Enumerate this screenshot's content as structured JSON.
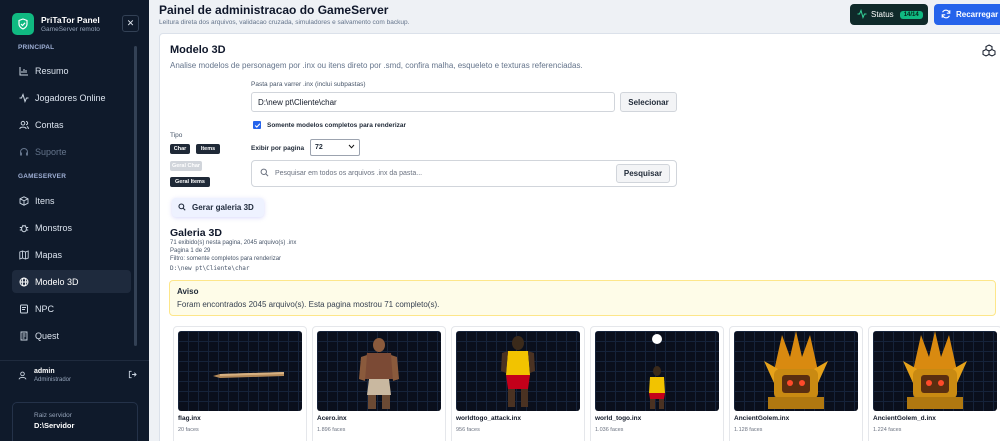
{
  "brand": {
    "title": "PriTaTor Panel",
    "subtitle": "GameServer remoto"
  },
  "sidebar": {
    "section_principal": "PRINCIPAL",
    "section_gameserver": "GAMESERVER",
    "items": [
      {
        "label": "Resumo",
        "icon": "chart-icon"
      },
      {
        "label": "Jogadores Online",
        "icon": "activity-icon"
      },
      {
        "label": "Contas",
        "icon": "users-icon"
      },
      {
        "label": "Suporte",
        "icon": "support-icon"
      },
      {
        "label": "Itens",
        "icon": "box-icon"
      },
      {
        "label": "Monstros",
        "icon": "bug-icon"
      },
      {
        "label": "Mapas",
        "icon": "map-icon"
      },
      {
        "label": "Modelo 3D",
        "icon": "globe-icon"
      },
      {
        "label": "NPC",
        "icon": "npc-icon"
      },
      {
        "label": "Quest",
        "icon": "quest-icon"
      }
    ],
    "user": {
      "name": "admin",
      "role": "Administrador"
    },
    "root": {
      "label": "Raiz servidor",
      "value": "D:\\Servidor"
    }
  },
  "header": {
    "title": "Painel de administracao do GameServer",
    "subtitle": "Leitura direta dos arquivos, validacao cruzada, simuladores e salvamento com backup.",
    "status_label": "Status",
    "status_badge": "14/14",
    "reload_label": "Recarregar"
  },
  "model3d": {
    "title": "Modelo 3D",
    "subtitle": "Analise modelos de personagem por .inx ou itens direto por .smd, confira malha, esqueleto e texturas referenciadas.",
    "path_label": "Pasta para varrer .inx (inclui subpastas)",
    "path_value": "D:\\new pt\\Cliente\\char",
    "select_label": "Selecionar",
    "only_complete_label": "Somente modelos completos para renderizar",
    "per_page_label": "Exibir por pagina",
    "per_page_value": "72",
    "search_placeholder": "Pesquisar em todos os arquivos .inx da pasta...",
    "search_button": "Pesquisar",
    "type_label": "Tipo",
    "type_chips": [
      "Char",
      "Items",
      "Geral Char",
      "Geral Items"
    ],
    "gallery_button": "Gerar galeria 3D"
  },
  "gallery": {
    "title": "Galeria 3D",
    "meta1": "71 exibido(s) nesta pagina, 2045 arquivo(s) .inx",
    "meta2": "Pagina 1 de 29",
    "meta3": "Filtro: somente completos para renderizar",
    "path": "D:\\new pt\\Cliente\\char",
    "alert_title": "Aviso",
    "alert_text": "Foram encontrados 2045 arquivo(s). Esta pagina mostrou 71 completo(s).",
    "tiles": [
      {
        "name": "flag.inx",
        "faces": "20 faces"
      },
      {
        "name": "Acero.inx",
        "faces": "1.896 faces"
      },
      {
        "name": "worldtogo_attack.inx",
        "faces": "956 faces"
      },
      {
        "name": "world_togo.inx",
        "faces": "1.036 faces"
      },
      {
        "name": "AncientGolem.inx",
        "faces": "1.128 faces"
      },
      {
        "name": "AncientGolem_d.inx",
        "faces": "1.224 faces"
      }
    ]
  }
}
